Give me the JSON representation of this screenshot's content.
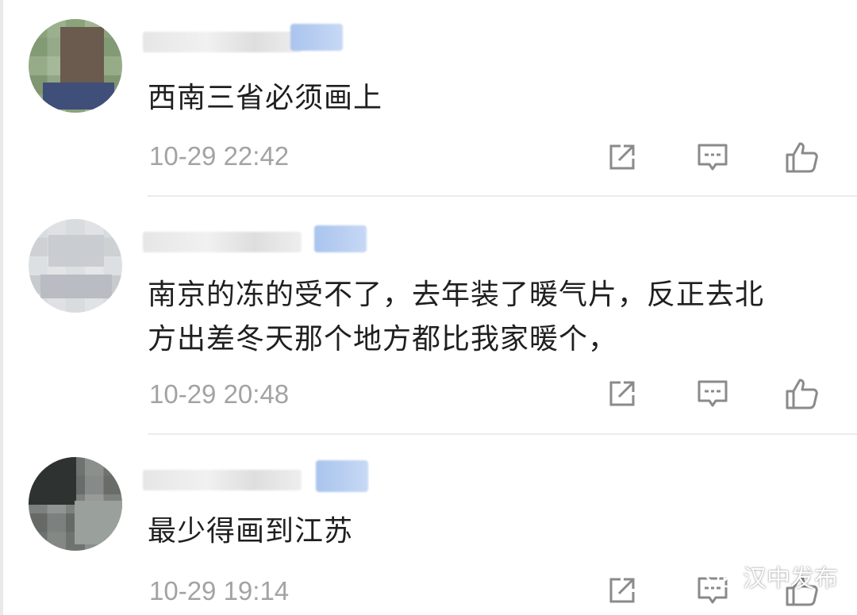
{
  "comments": [
    {
      "text": "西南三省必须画上",
      "time": "10-29 22:42"
    },
    {
      "text_line1": "南京的冻的受不了，去年装了暖气片，反正去北",
      "text_line2": "方出差冬天那个地方都比我家暖个，",
      "time": "10-29 20:48"
    },
    {
      "text": "最少得画到江苏",
      "time": "10-29 19:14"
    }
  ],
  "icons": {
    "share": "share-icon",
    "reply": "comment-icon",
    "like": "thumbs-up-icon"
  },
  "watermark": {
    "label": "汉中发布",
    "icon": "wechat-icon"
  },
  "colors": {
    "text": "#1f1f1f",
    "meta": "#a3a3a3",
    "divider": "#ececec",
    "badge": "#a9c4ee"
  }
}
